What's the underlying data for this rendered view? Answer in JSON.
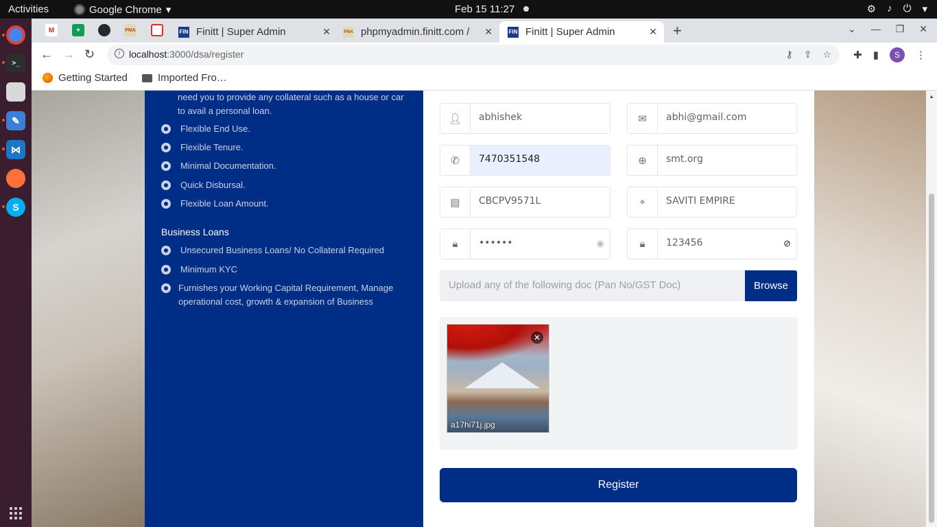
{
  "system": {
    "activities": "Activities",
    "app_name": "Google Chrome",
    "clock": "Feb 15  11:27"
  },
  "dock": {
    "items": [
      "chrome-icon",
      "terminal-icon",
      "files-icon",
      "text-editor-icon",
      "vscode-icon",
      "firefox-icon",
      "skype-icon"
    ]
  },
  "tabs": [
    {
      "title": "Finitt | Super Admin",
      "favicon": "FIN"
    },
    {
      "title": "phpmyadmin.finitt.com /",
      "favicon": "PMA"
    },
    {
      "title": "Finitt | Super Admin",
      "favicon": "FIN",
      "active": true
    }
  ],
  "address_bar": {
    "host": "localhost",
    "path": ":3000/dsa/register"
  },
  "bookmarks": [
    "Getting Started",
    "Imported Fro…"
  ],
  "left_panel": {
    "note": "need you to provide any collateral such as a house or car to avail a personal loan.",
    "personal_features": [
      "Flexible End Use.",
      "Flexible Tenure.",
      "Minimal Documentation.",
      "Quick Disbursal.",
      "Flexible Loan Amount."
    ],
    "business_title": "Business Loans",
    "business_features": [
      "Unsecured Business Loans/ No Collateral Required",
      "Minimum KYC",
      "Furnishes your Working Capital Requirement, Manage operational cost, growth & expansion of Business"
    ]
  },
  "form": {
    "name": "abhishek",
    "email": "abhi@gmail.com",
    "phone": "7470351548",
    "website": "smt.org",
    "pan": "CBCPV9571L",
    "address": "SAVITI EMPIRE",
    "password": "••••••",
    "confirm_password": "123456",
    "upload_placeholder": "Upload any of the following doc (Pan No/GST Doc)",
    "browse_label": "Browse",
    "file_name": "a17hi71j.jpg",
    "register_label": "Register"
  },
  "colors": {
    "brand_navy": "#002e86",
    "focus_fill": "#e8f0fe"
  }
}
